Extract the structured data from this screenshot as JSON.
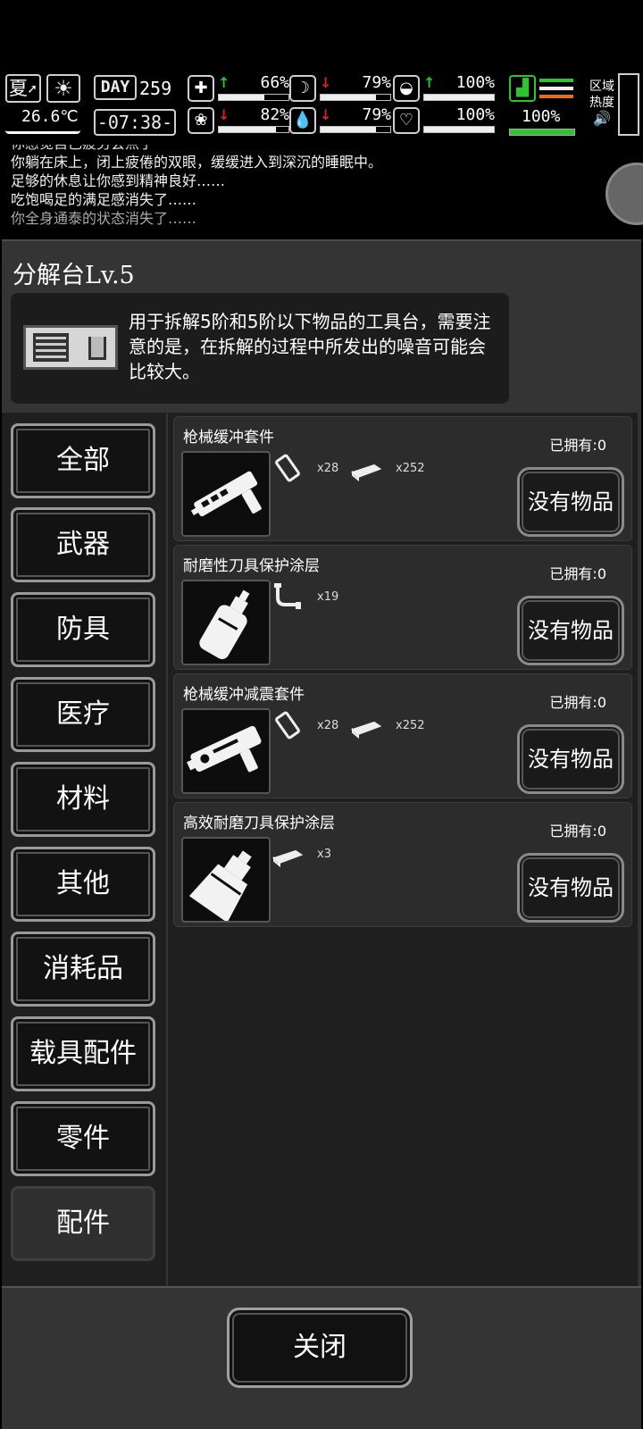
{
  "hud": {
    "season": "夏",
    "weather_icon": "sun-icon",
    "temperature": "26.6℃",
    "day_label": "DAY",
    "day_number": "259",
    "clock": "-07:38-",
    "stats": [
      {
        "icon": "medkit-icon",
        "direction": "up",
        "percent": "66%",
        "level": 0.66
      },
      {
        "icon": "stomach-icon",
        "direction": "down",
        "percent": "79%",
        "level": 0.79
      },
      {
        "icon": "mask-icon",
        "direction": "up",
        "percent": "100%",
        "level": 1.0
      },
      {
        "icon": "brain-icon",
        "direction": "down",
        "percent": "82%",
        "level": 0.82
      },
      {
        "icon": "water-drop-icon",
        "direction": "down",
        "percent": "79%",
        "level": 0.79
      },
      {
        "icon": "heart-icon",
        "direction": "none",
        "percent": "100%",
        "level": 1.0
      }
    ],
    "stamina": {
      "icon": "boot-icon",
      "percent": "100%",
      "level": 1.0,
      "stripe_colors": [
        "#2ec42e",
        "#f0f0f0",
        "#e0701c"
      ]
    },
    "zone_label_1": "区域",
    "zone_label_2": "热度",
    "speaker_icon": "speaker-icon",
    "up_color": "#2ec42e",
    "down_color": "#e02020"
  },
  "log": {
    "lines": [
      "你感觉自己疲劳会点了",
      "你躺在床上，闭上疲倦的双眼，缓缓进入到深沉的睡眠中。",
      "足够的休息让你感到精神良好……",
      "吃饱喝足的满足感消失了……",
      "你全身通泰的状态消失了……"
    ]
  },
  "panel": {
    "title": "分解台Lv.5",
    "description": "用于拆解5阶和5阶以下物品的工具台，需要注意的是，在拆解的过程中所发出的噪音可能会比较大。"
  },
  "categories": [
    {
      "label": "全部",
      "name": "category-all"
    },
    {
      "label": "武器",
      "name": "category-weapon"
    },
    {
      "label": "防具",
      "name": "category-armor"
    },
    {
      "label": "医疗",
      "name": "category-medical"
    },
    {
      "label": "材料",
      "name": "category-material"
    },
    {
      "label": "其他",
      "name": "category-other"
    },
    {
      "label": "消耗品",
      "name": "category-consumable"
    },
    {
      "label": "载具配件",
      "name": "category-vehicle-parts"
    },
    {
      "label": "零件",
      "name": "category-parts"
    },
    {
      "label": "配件",
      "name": "category-accessories",
      "active": true
    }
  ],
  "items": [
    {
      "name": "枪械缓冲套件",
      "icon": "gun-buffer-kit-icon",
      "owned": "已拥有:0",
      "button": "没有物品",
      "materials": [
        {
          "icon": "plate-icon",
          "qty": "x28"
        },
        {
          "icon": "metal-bar-icon",
          "qty": "x252"
        }
      ]
    },
    {
      "name": "耐磨性刀具保护涂层",
      "icon": "spray-bottle-icon",
      "owned": "已拥有:0",
      "button": "没有物品",
      "materials": [
        {
          "icon": "pipe-fitting-icon",
          "qty": "x19"
        }
      ]
    },
    {
      "name": "枪械缓冲减震套件",
      "icon": "gun-shock-kit-icon",
      "owned": "已拥有:0",
      "button": "没有物品",
      "materials": [
        {
          "icon": "plate-icon",
          "qty": "x28"
        },
        {
          "icon": "metal-bar-icon",
          "qty": "x252"
        }
      ]
    },
    {
      "name": "高效耐磨刀具保护涂层",
      "icon": "coating-can-icon",
      "owned": "已拥有:0",
      "button": "没有物品",
      "materials": [
        {
          "icon": "metal-bar-icon",
          "qty": "x3"
        }
      ]
    }
  ],
  "footer": {
    "close_label": "关闭"
  }
}
